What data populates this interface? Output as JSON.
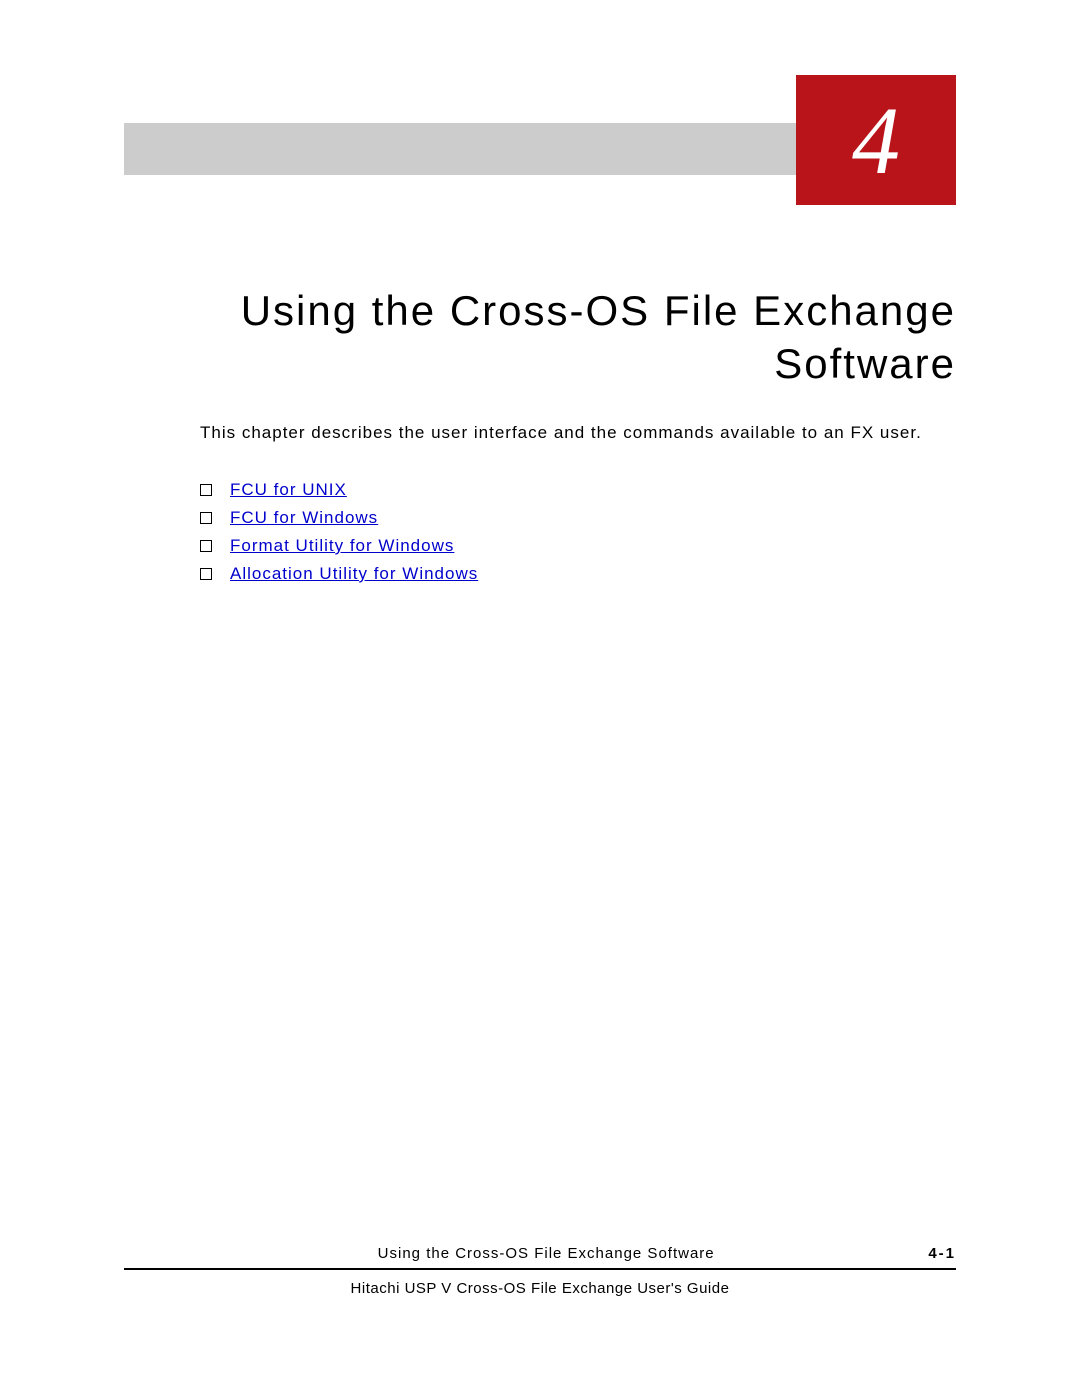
{
  "chapter": {
    "number": "4",
    "title": "Using the Cross-OS File Exchange Software"
  },
  "intro": "This chapter describes the user interface and the commands available to an FX user.",
  "links": [
    {
      "label": "FCU for UNIX"
    },
    {
      "label": "FCU for Windows"
    },
    {
      "label": "Format Utility for Windows"
    },
    {
      "label": "Allocation Utility for Windows"
    }
  ],
  "footer": {
    "section_title": "Using the Cross-OS File Exchange Software",
    "page_number": "4-1",
    "guide_title": "Hitachi USP V Cross-OS File Exchange User's Guide"
  }
}
